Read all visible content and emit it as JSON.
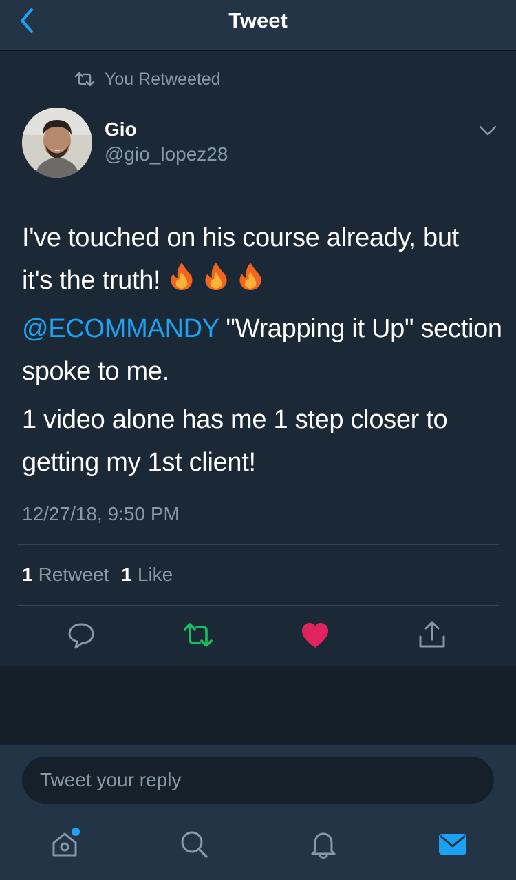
{
  "header": {
    "title": "Tweet"
  },
  "retweet_notice": "You Retweeted",
  "author": {
    "name": "Gio",
    "handle": "@gio_lopez28"
  },
  "tweet": {
    "line1": "I've touched on his course already, but",
    "line2": "it's the truth!",
    "mention": "@ECOMMANDY",
    "para2_rest": " \"Wrapping it Up\" section spoke to me.",
    "para3": "1 video alone has me 1 step closer to getting my 1st client!",
    "timestamp": "12/27/18, 9:50 PM"
  },
  "stats": {
    "retweets_count": "1",
    "retweets_label": "Retweet",
    "likes_count": "1",
    "likes_label": "Like"
  },
  "reply": {
    "placeholder": "Tweet your reply"
  },
  "icons": {
    "back": "chevron-left-icon",
    "caret": "chevron-down-icon",
    "reply": "comment-icon",
    "retweet": "retweet-icon",
    "like": "heart-icon",
    "share": "share-icon",
    "home": "home-icon",
    "search": "search-icon",
    "notifications": "bell-icon",
    "messages": "mail-icon"
  },
  "colors": {
    "accent": "#1da1f2",
    "retweet_green": "#17bf63",
    "like_red": "#e0245e",
    "muted": "#8899a6",
    "background": "#15202b",
    "card": "#1b2836",
    "bars": "#243447"
  }
}
